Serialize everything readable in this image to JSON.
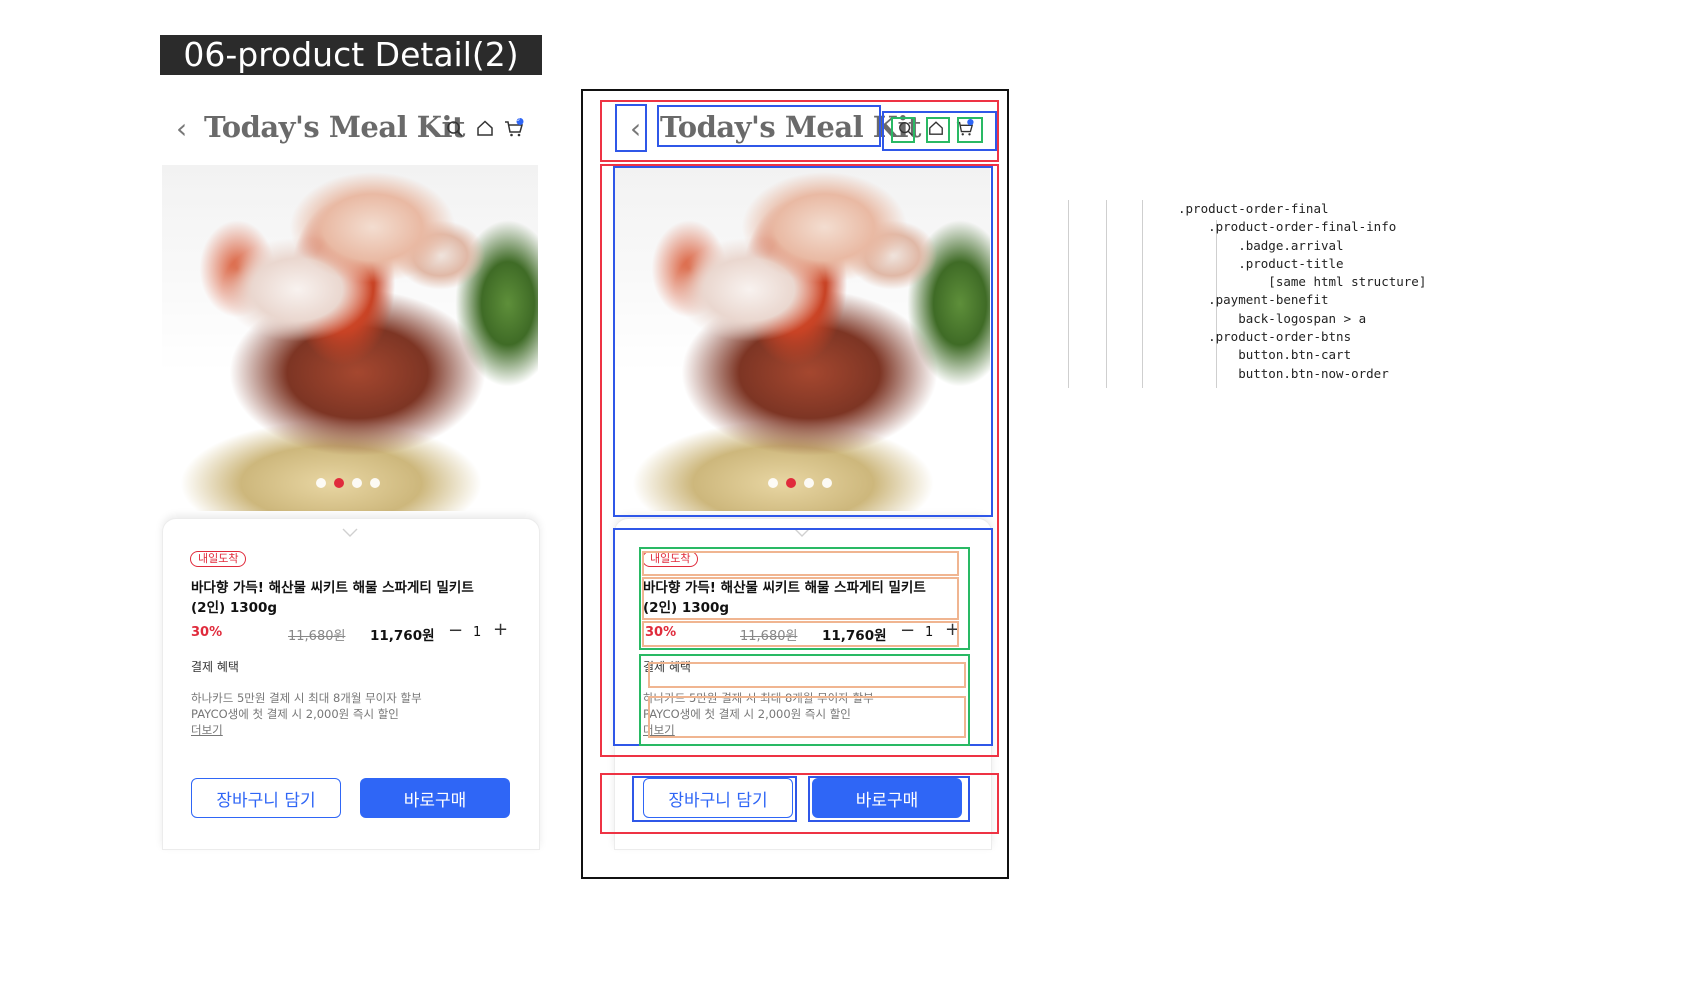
{
  "page_label": "06-product Detail(2)",
  "header": {
    "back_glyph": "‹",
    "title": "Today's Meal Kit",
    "icons": [
      "search-icon",
      "home-icon",
      "cart-icon"
    ],
    "cart_count": "0"
  },
  "hero": {
    "slides": 4,
    "active_index": 1
  },
  "product": {
    "badge": "내일도착",
    "title_line1": "바다향 가득! 해산물 씨키트 해물 스파게티 밀키트",
    "title_line2": "(2인) 1300g",
    "discount_rate": "30%",
    "original_price": "11,680원",
    "price": "11,760원",
    "quantity": "1",
    "minus": "−",
    "plus": "+"
  },
  "benefit": {
    "heading": "결제 혜택",
    "line1": "하나카드 5만원 결제 시 최대 8개월 무이자 할부",
    "line2": "PAYCO생에 첫 결제 시 2,000원 즉시 할인",
    "more": "더보기"
  },
  "buttons": {
    "cart": "장바구니 담기",
    "order": "바로구매"
  },
  "code": ".product-order-final\n    .product-order-final-info\n        .badge.arrival\n        .product-title\n            [same html structure]\n    .payment-benefit\n        back-logospan > a\n    .product-order-btns\n        button.btn-cart\n        button.btn-now-order",
  "colors": {
    "accent": "#2f66f6",
    "sale": "#e02b3c",
    "annotation_red": "#ee3344",
    "annotation_blue": "#2f57e8",
    "annotation_green": "#29b964",
    "annotation_peach": "#f0b591"
  }
}
